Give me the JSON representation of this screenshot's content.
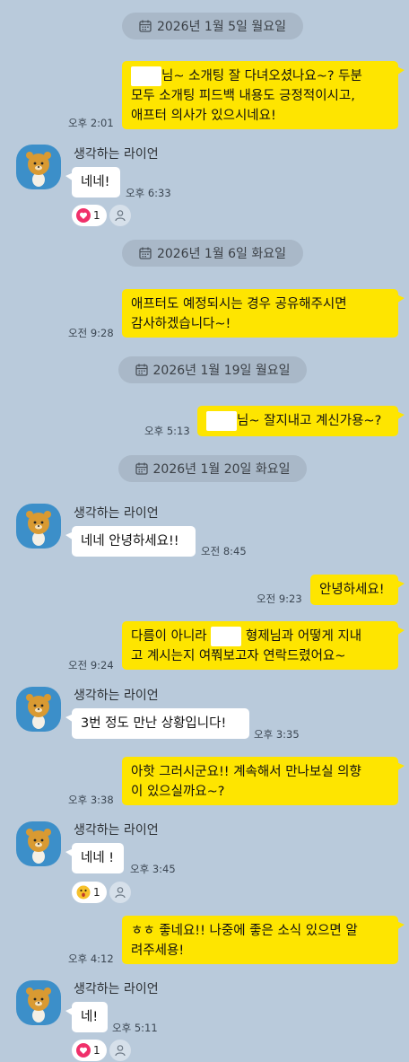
{
  "dates": [
    "2026년 1월 5일 월요일",
    "2026년 1월 6일 화요일",
    "2026년 1월 19일 월요일",
    "2026년 1월 20일 화요일"
  ],
  "sender_name": "생각하는 라이언",
  "messages": [
    {
      "lines": [
        "님~ 소개팅 잘 다녀오셨나요~? 두분",
        "모두 소개팅 피드백 내용도 긍정적이시고,",
        "애프터 의사가 있으시네요!"
      ],
      "time": "오후 2:01"
    },
    {
      "text": "네네!",
      "time": "오후 6:33",
      "reaction_count": "1"
    },
    {
      "lines": [
        "애프터도 예정되시는 경우 공유해주시면",
        "감사하겠습니다~!"
      ],
      "time": "오전 9:28"
    },
    {
      "text": "님~ 잘지내고 계신가용~?",
      "time": "오후 5:13"
    },
    {
      "text": "네네 안녕하세요!!",
      "time": "오전 8:45"
    },
    {
      "text": "안녕하세요!",
      "time": "오전 9:23"
    },
    {
      "line1_pre": "다름이 아니라 ",
      "line1_post": " 형제님과 어떻게 지내",
      "line2": "고 계시는지 여쭤보고자 연락드렸어요~",
      "time": "오전 9:24"
    },
    {
      "text": "3번 정도 만난 상황입니다!",
      "time": "오후 3:35"
    },
    {
      "lines": [
        "아핫 그러시군요!! 계속해서 만나보실 의향",
        "이 있으실까요~?"
      ],
      "time": "오후 3:38"
    },
    {
      "text": "네네 !",
      "time": "오후 3:45",
      "reaction_count": "1"
    },
    {
      "lines": [
        "ㅎㅎ 좋네요!! 나중에 좋은 소식 있으면 알",
        "려주세용!"
      ],
      "time": "오후 4:12"
    },
    {
      "text": "네!",
      "time": "오후 5:11",
      "reaction_count": "1"
    }
  ]
}
